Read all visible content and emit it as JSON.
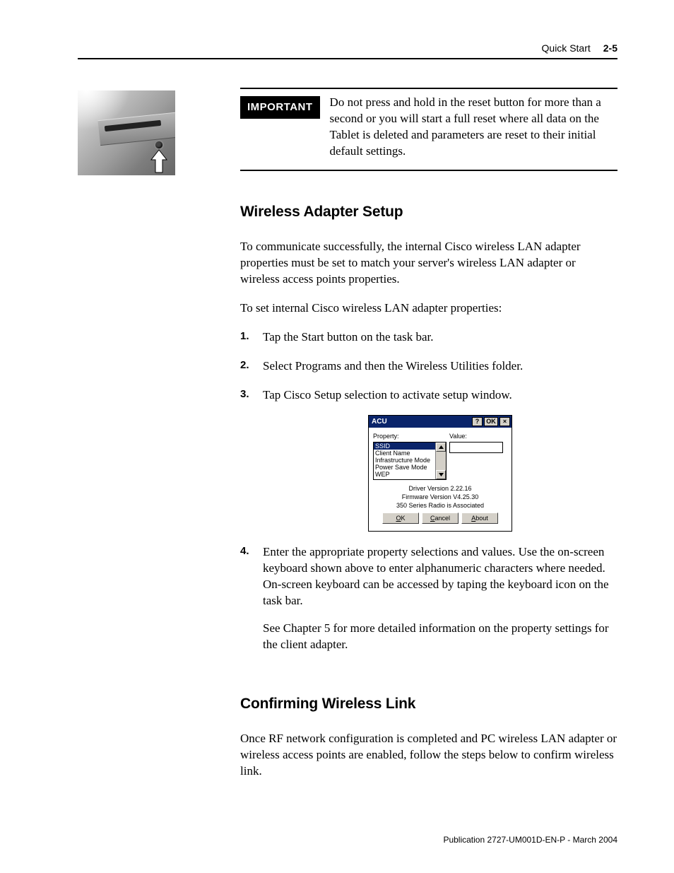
{
  "header": {
    "section": "Quick Start",
    "page": "2-5"
  },
  "important": {
    "badge": "IMPORTANT",
    "text": "Do not press and hold in the reset button for more than a second or you will start a full reset where all data on the Tablet is deleted and parameters are reset to their initial default settings."
  },
  "section1": {
    "title": "Wireless Adapter Setup",
    "p1": "To communicate successfully, the internal Cisco wireless LAN adapter properties must be set to match your server's wireless LAN adapter or wireless access points properties.",
    "p2": "To set internal Cisco wireless LAN adapter properties:",
    "steps": {
      "s1": "Tap the Start button on the task bar.",
      "s2": "Select Programs and then the Wireless Utilities folder.",
      "s3": "Tap Cisco Setup selection to activate setup window.",
      "s4a": "Enter the appropriate property selections and values. Use the on-screen keyboard shown above to enter alphanumeric characters where needed. On-screen keyboard can be accessed by taping the keyboard icon on the task bar.",
      "s4b": "See Chapter 5 for more detailed information on the property settings for the client adapter."
    }
  },
  "dialog": {
    "title": "ACU",
    "btn_help": "?",
    "btn_ok": "OK",
    "btn_close": "×",
    "property_label": "Property:",
    "value_label": "Value:",
    "items": {
      "i0": "SSID",
      "i1": "Client Name",
      "i2": "Infrastructure Mode",
      "i3": "Power Save Mode",
      "i4": "WEP"
    },
    "value": "",
    "status1": "Driver Version 2.22.16",
    "status2": "Firmware Version V4.25.30",
    "status3": "350 Series Radio is Associated",
    "buttons": {
      "ok": "OK",
      "cancel": "Cancel",
      "about": "About"
    }
  },
  "section2": {
    "title": "Confirming Wireless Link",
    "p1": "Once RF network configuration is completed and PC wireless LAN adapter or wireless access points are enabled, follow the steps below to confirm wireless link."
  },
  "footer": "Publication 2727-UM001D-EN-P - March 2004"
}
